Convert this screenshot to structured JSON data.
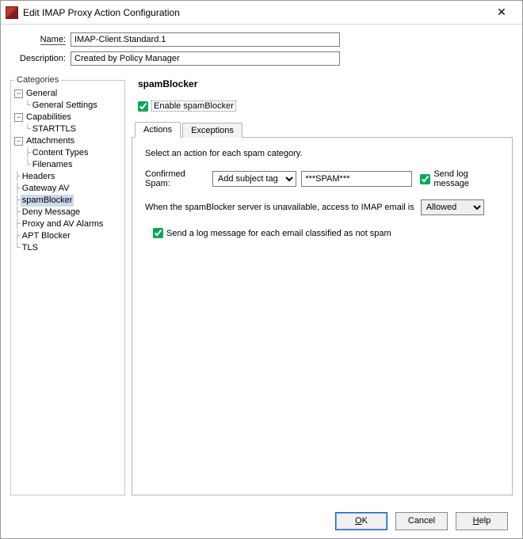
{
  "window": {
    "title": "Edit IMAP Proxy Action Configuration",
    "close_glyph": "✕"
  },
  "form": {
    "name_label": "Name:",
    "name_value": "IMAP-Client.Standard.1",
    "desc_label": "Description:",
    "desc_value": "Created by Policy Manager"
  },
  "categories": {
    "legend": "Categories",
    "nodes": {
      "general": "General",
      "general_settings": "General Settings",
      "capabilities": "Capabilities",
      "starttls": "STARTTLS",
      "attachments": "Attachments",
      "content_types": "Content Types",
      "filenames": "Filenames",
      "headers": "Headers",
      "gateway_av": "Gateway AV",
      "spamblocker": "spamBlocker",
      "deny_message": "Deny Message",
      "proxy_av_alarms": "Proxy and AV Alarms",
      "apt_blocker": "APT Blocker",
      "tls": "TLS"
    }
  },
  "panel": {
    "title": "spamBlocker",
    "enable_label": "Enable spamBlocker",
    "enable_checked": true
  },
  "tabs": {
    "actions": "Actions",
    "exceptions": "Exceptions"
  },
  "actions": {
    "hint": "Select an action for each spam category.",
    "confirmed_label": "Confirmed Spam:",
    "confirmed_action": "Add subject tag",
    "confirmed_tag": "***SPAM***",
    "send_log_label": "Send log message",
    "send_log_checked": true,
    "unavailable_text": "When the spamBlocker server is unavailable, access to IMAP email is",
    "unavailable_value": "Allowed",
    "not_spam_log_label": "Send a log message for each email classified as not spam",
    "not_spam_log_checked": true
  },
  "buttons": {
    "ok": "OK",
    "cancel": "Cancel",
    "help": "Help"
  }
}
